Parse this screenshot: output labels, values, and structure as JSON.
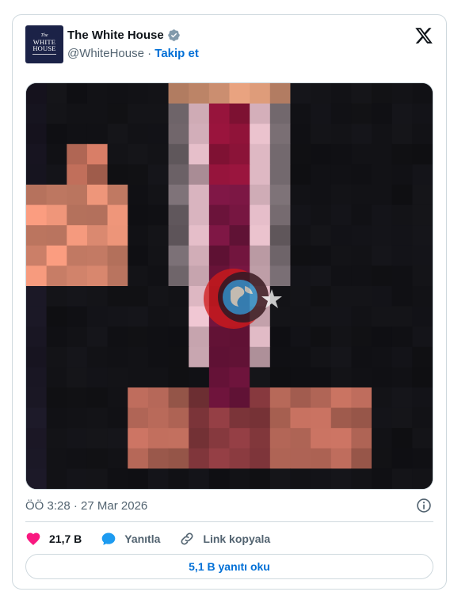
{
  "author": {
    "display_name": "The White House",
    "handle": "@WhiteHouse",
    "separator": "·",
    "follow_label": "Takip et",
    "avatar_text": {
      "the": "The",
      "main": "WHITE HOUSE"
    },
    "verified_color": "#829aab",
    "avatar_bg": "#1b2247"
  },
  "icons": {
    "platform": "x-logo-icon",
    "verified": "verified-badge-icon",
    "info": "info-icon",
    "like": "heart-icon",
    "reply": "speech-bubble-icon",
    "copy_link": "link-icon"
  },
  "media": {
    "type": "pixelated-image",
    "overlay": "crescent-star-globe-watermark"
  },
  "timestamp": "ÖÖ 3:28 · 27 Mar 2026",
  "actions": {
    "likes": "21,7 B",
    "reply_label": "Yanıtla",
    "copy_link_label": "Link kopyala"
  },
  "read_replies_label": "5,1 B yanıtı oku",
  "colors": {
    "link_blue": "#006fd6",
    "heart": "#f91880",
    "reply_bubble": "#1d9bf0",
    "border": "#cfd9de",
    "secondary_text": "#536471"
  }
}
